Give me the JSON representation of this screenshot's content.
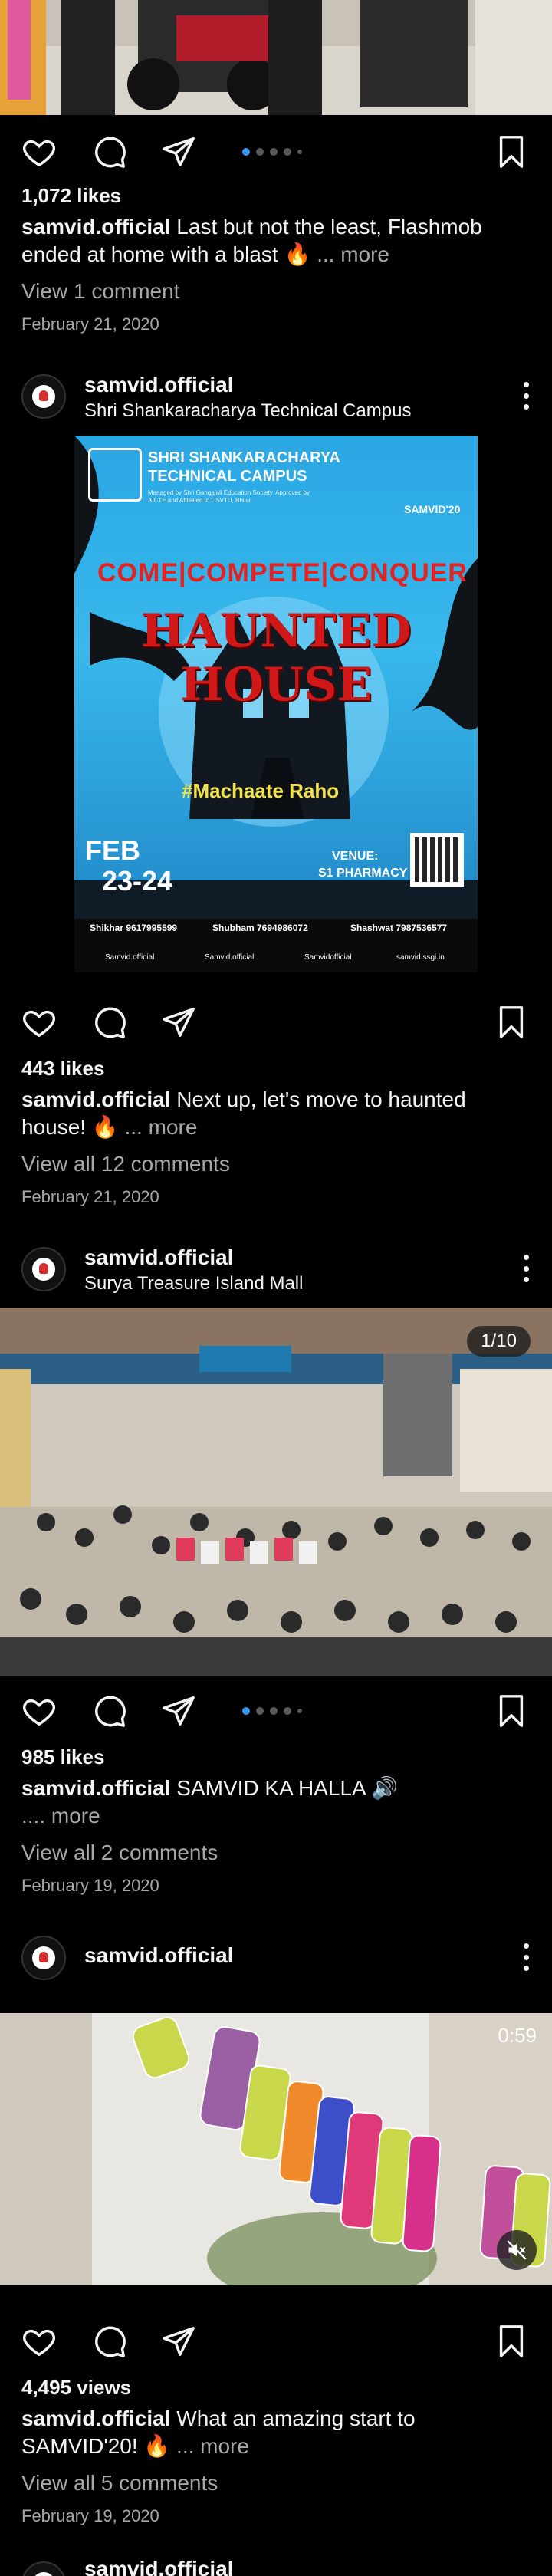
{
  "colors": {
    "background": "#000000",
    "accent": "#3797f0",
    "muted": "#a8a8a8",
    "text": "#f5f5f5"
  },
  "posts": [
    {
      "likes": "1,072 likes",
      "username": "samvid.official",
      "caption": "Last but not the least, Flashmob ended at home with a blast 🔥",
      "more": "... more",
      "comments": "View 1 comment",
      "date": "February 21, 2020"
    },
    {
      "username": "samvid.official",
      "location": "Shri Shankaracharya Technical Campus",
      "poster": {
        "institute_line1": "SHRI SHANKARACHARYA",
        "institute_line2": "TECHNICAL CAMPUS",
        "institute_sub": "Managed by Shri Gangajali Education Society. Approved by AICTE and Affiliated to CSVTU, Bhilai",
        "brand": "SAMVID'20",
        "tagline": "COME|COMPETE|CONQUER",
        "event": "HAUNTED HOUSE",
        "hashtag": "#Machaate Raho",
        "month": "FEB",
        "days": "23-24",
        "venue_label": "VENUE:",
        "venue": "S1 PHARMACY",
        "contact1": "Shikhar 9617995599",
        "contact2": "Shubham 7694986072",
        "contact3": "Shashwat 7987536577",
        "social1": "Samvid.official",
        "social2": "Samvid.official",
        "social3": "Samvidofficial",
        "social4": "samvid.ssgi.in"
      },
      "likes": "443 likes",
      "caption": "Next up, let's move to haunted house! 🔥",
      "more": "... more",
      "comments": "View all 12 comments",
      "date": "February 21, 2020"
    },
    {
      "username": "samvid.official",
      "location": "Surya Treasure Island Mall",
      "counter": "1/10",
      "likes": "985 likes",
      "caption": "SAMVID KA HALLA 🔊",
      "more": ".... more",
      "comments": "View all 2 comments",
      "date": "February 19, 2020"
    },
    {
      "username": "samvid.official",
      "duration": "0:59",
      "views": "4,495 views",
      "caption": "What an amazing start to SAMVID'20! 🔥",
      "more": "... more",
      "comments": "View all 5 comments",
      "date": "February 19, 2020"
    },
    {
      "username": "samvid.official"
    }
  ],
  "icons": [
    "heart-icon",
    "comment-icon",
    "share-icon",
    "bookmark-icon",
    "more-options-icon",
    "mute-icon"
  ]
}
